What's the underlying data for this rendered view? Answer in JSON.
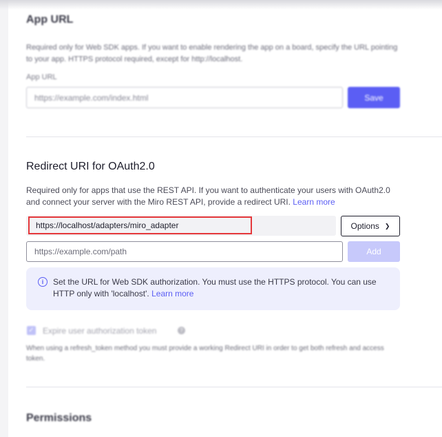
{
  "app_url": {
    "heading": "App URL",
    "description": "Required only for Web SDK apps. If you want to enable rendering the app on a board, specify the URL pointing to your app. HTTPS protocol required, except for http://localhost.",
    "field_label": "App URL",
    "placeholder": "https://example.com/index.html",
    "save_label": "Save"
  },
  "redirect": {
    "heading": "Redirect URI for OAuth2.0",
    "description": "Required only for apps that use the REST API. If you want to authenticate your users with OAuth2.0 and connect your server with the Miro REST API, provide a redirect URI.",
    "learn_more": "Learn more",
    "uri_value": "https://localhost/adapters/miro_adapter",
    "options_label": "Options",
    "path_placeholder": "https://example.com/path",
    "add_label": "Add",
    "info_text": "Set the URL for Web SDK authorization. You must use the HTTPS protocol. You can use HTTP only with 'localhost'.",
    "info_learn_more": "Learn more",
    "expire_label": "Expire user authorization token",
    "expire_checked": true,
    "note": "When using a refresh_token method you must provide a working Redirect URI in order to get both refresh and access token."
  },
  "permissions": {
    "heading": "Permissions"
  }
}
